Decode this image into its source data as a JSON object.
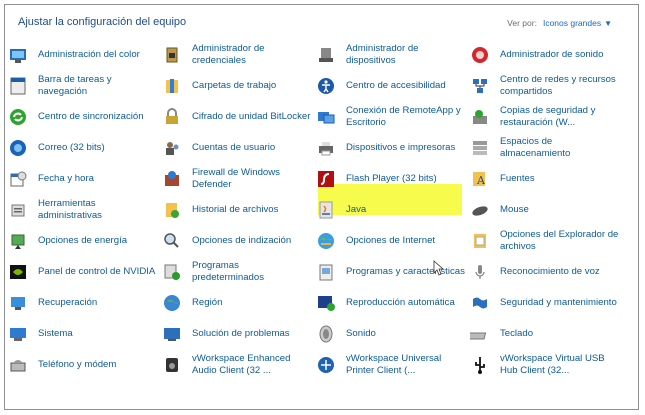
{
  "header": {
    "title": "Ajustar la configuración del equipo",
    "view_by_label": "Ver por:",
    "view_by_value": "Iconos grandes"
  },
  "items": [
    {
      "label": "Administración del color",
      "icon": "color-management-icon"
    },
    {
      "label": "Barra de tareas y navegación",
      "icon": "taskbar-icon"
    },
    {
      "label": "Centro de sincronización",
      "icon": "sync-center-icon"
    },
    {
      "label": "Correo (32 bits)",
      "icon": "mail-icon"
    },
    {
      "label": "Fecha y hora",
      "icon": "clock-calendar-icon"
    },
    {
      "label": "Herramientas administrativas",
      "icon": "admin-tools-icon"
    },
    {
      "label": "Opciones de energía",
      "icon": "power-icon"
    },
    {
      "label": "Panel de control de NVIDIA",
      "icon": "nvidia-icon"
    },
    {
      "label": "Recuperación",
      "icon": "recovery-icon"
    },
    {
      "label": "Sistema",
      "icon": "system-icon"
    },
    {
      "label": "Teléfono y módem",
      "icon": "phone-modem-icon"
    },
    {
      "label": "Administrador de credenciales",
      "icon": "credential-manager-icon"
    },
    {
      "label": "Carpetas de trabajo",
      "icon": "work-folders-icon"
    },
    {
      "label": "Cifrado de unidad BitLocker",
      "icon": "bitlocker-icon"
    },
    {
      "label": "Cuentas de usuario",
      "icon": "user-accounts-icon"
    },
    {
      "label": "Firewall de Windows Defender",
      "icon": "firewall-icon"
    },
    {
      "label": "Historial de archivos",
      "icon": "file-history-icon"
    },
    {
      "label": "Opciones de indización",
      "icon": "indexing-icon"
    },
    {
      "label": "Programas predeterminados",
      "icon": "default-programs-icon"
    },
    {
      "label": "Región",
      "icon": "region-icon"
    },
    {
      "label": "Solución de problemas",
      "icon": "troubleshooting-icon"
    },
    {
      "label": "vWorkspace Enhanced Audio Client (32 ...",
      "icon": "audio-client-icon"
    },
    {
      "label": "Administrador de dispositivos",
      "icon": "device-manager-icon"
    },
    {
      "label": "Centro de accesibilidad",
      "icon": "accessibility-icon"
    },
    {
      "label": "Conexión de RemoteApp y Escritorio",
      "icon": "remoteapp-icon"
    },
    {
      "label": "Dispositivos e impresoras",
      "icon": "printer-icon"
    },
    {
      "label": "Flash Player (32 bits)",
      "icon": "flash-icon"
    },
    {
      "label": "Java",
      "icon": "java-icon"
    },
    {
      "label": "Opciones de Internet",
      "icon": "internet-options-icon"
    },
    {
      "label": "Programas y características",
      "icon": "programs-features-icon"
    },
    {
      "label": "Reproducción automática",
      "icon": "autoplay-icon"
    },
    {
      "label": "Sonido",
      "icon": "speaker-icon"
    },
    {
      "label": "vWorkspace Universal Printer Client (...",
      "icon": "universal-printer-icon"
    },
    {
      "label": "Administrador de sonido",
      "icon": "sound-manager-icon"
    },
    {
      "label": "Centro de redes y recursos compartidos",
      "icon": "network-center-icon"
    },
    {
      "label": "Copias de seguridad y restauración (W...",
      "icon": "backup-icon"
    },
    {
      "label": "Espacios de almacenamiento",
      "icon": "storage-spaces-icon"
    },
    {
      "label": "Fuentes",
      "icon": "fonts-icon"
    },
    {
      "label": "Mouse",
      "icon": "mouse-icon"
    },
    {
      "label": "Opciones del Explorador de archivos",
      "icon": "explorer-options-icon"
    },
    {
      "label": "Reconocimiento de voz",
      "icon": "microphone-icon"
    },
    {
      "label": "Seguridad y mantenimiento",
      "icon": "flag-icon"
    },
    {
      "label": "Teclado",
      "icon": "keyboard-icon"
    },
    {
      "label": "vWorkspace Virtual USB Hub Client (32...",
      "icon": "usb-icon"
    }
  ]
}
